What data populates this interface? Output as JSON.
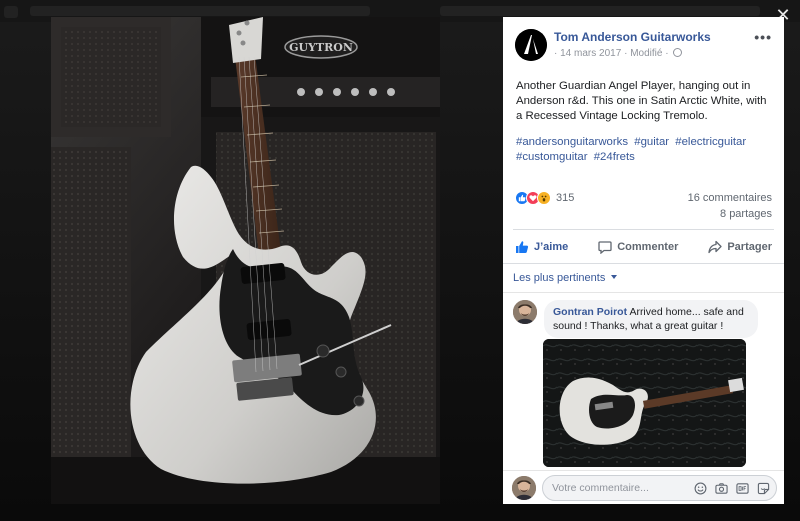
{
  "viewer": {
    "close_glyph": "✕",
    "brand_text": "GUYTRON"
  },
  "post": {
    "page_name": "Tom Anderson Guitarworks",
    "date": "14 mars 2017",
    "edited_label": "Modifié",
    "separator": "·",
    "more_glyph": "•••",
    "text": "Another Guardian Angel Player, hanging out in Anderson r&d. This one in Satin Arctic White, with a Recessed Vintage Locking Tremolo.",
    "hashtags": [
      "#andersonguitarworks",
      "#guitar",
      "#electricguitar",
      "#customguitar",
      "#24frets"
    ],
    "reaction_count": "315",
    "comments_count": "16 commentaires",
    "shares_count": "8 partages",
    "actions": {
      "like": "J’aime",
      "comment": "Commenter",
      "share": "Partager"
    }
  },
  "comments": {
    "sort_label": "Les plus pertinents",
    "items": [
      {
        "author": "Gontran Poirot",
        "text": "Arrived home... safe and sound ! Thanks, what a great guitar !"
      }
    ]
  },
  "composer": {
    "placeholder": "Votre commentaire..."
  },
  "colors": {
    "link_blue": "#385898",
    "like_blue": "#1877f2",
    "love_red": "#f33e58",
    "wow_yellow": "#f7b125",
    "guitar_body": "#d9d8d6",
    "pickguard": "#1a1a1a"
  },
  "icons": {
    "close": "close-icon",
    "globe": "globe-icon",
    "like": "thumbs-up-icon",
    "comment": "speech-bubble-icon",
    "share": "share-arrow-icon",
    "emoji": "emoji-icon",
    "camera": "camera-icon",
    "gif": "gif-icon",
    "sticker": "sticker-icon"
  }
}
